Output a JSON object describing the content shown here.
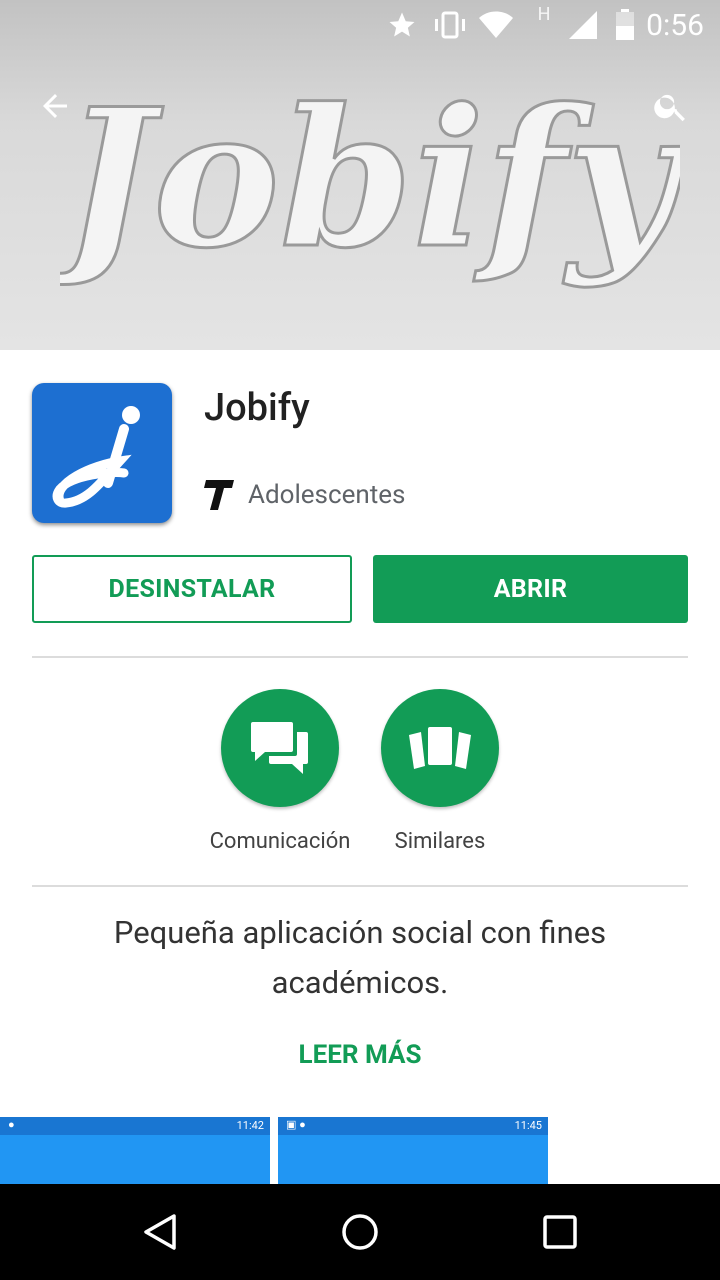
{
  "status_bar": {
    "time": "0:56",
    "network_letter": "H",
    "icons": [
      "star-icon",
      "vibrate-icon",
      "wifi-icon",
      "signal-icon",
      "battery-icon"
    ]
  },
  "header": {
    "banner_text": "Jobify",
    "back_icon": "arrow-left-icon",
    "search_icon": "search-icon"
  },
  "app": {
    "name": "Jobify",
    "rating_label": "Adolescentes",
    "icon_letter": "j"
  },
  "buttons": {
    "uninstall": "DESINSTALAR",
    "open": "ABRIR"
  },
  "chips": [
    {
      "label": "Comunicación",
      "icon": "chat-bubbles-icon"
    },
    {
      "label": "Similares",
      "icon": "cards-stack-icon"
    }
  ],
  "description": "Pequeña aplicación social con fines académicos.",
  "read_more": "LEER MÁS",
  "screenshots": [
    {
      "time": "11:42"
    },
    {
      "time": "11:45"
    }
  ],
  "colors": {
    "accent": "#129c56",
    "app_icon_blue": "#1d6fd1",
    "screenshot_blue": "#2196f3"
  }
}
